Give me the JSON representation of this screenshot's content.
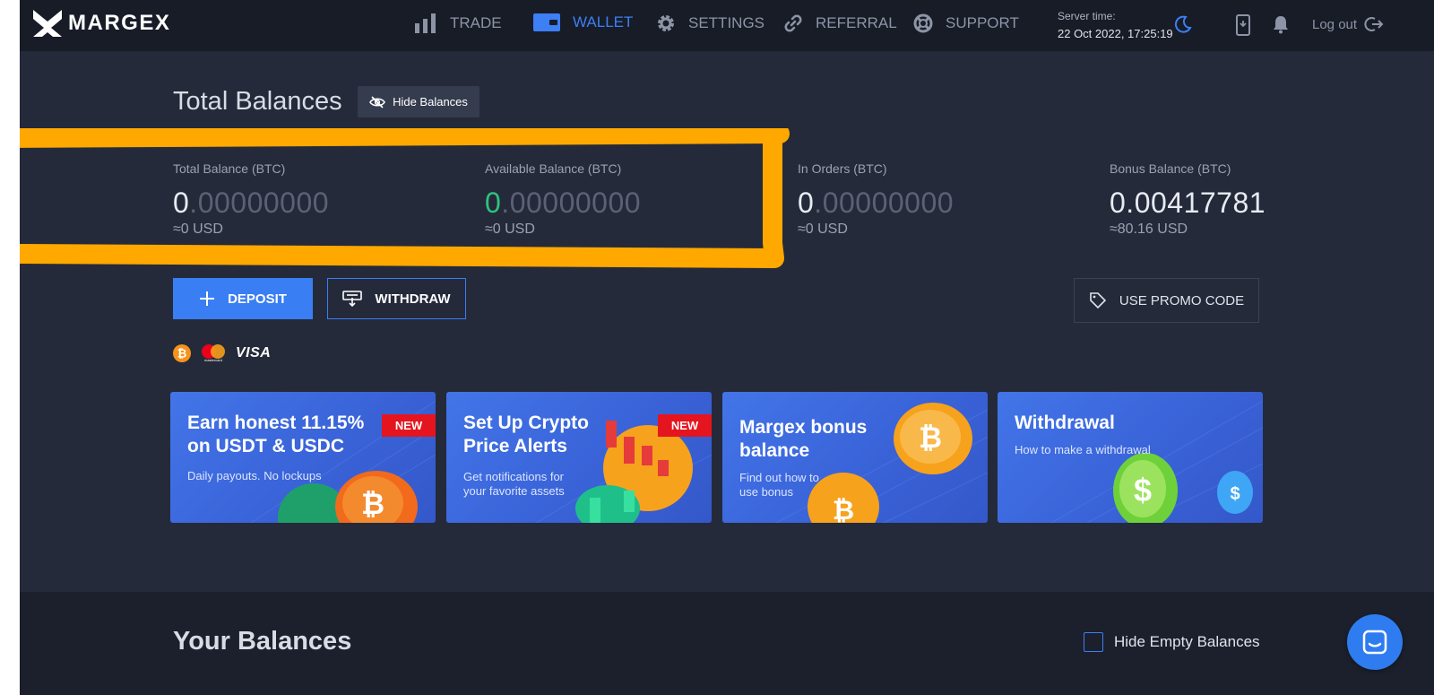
{
  "brand": {
    "name": "MARGEX"
  },
  "nav": [
    {
      "label": "TRADE",
      "icon": "bar-chart-icon"
    },
    {
      "label": "WALLET",
      "icon": "wallet-icon",
      "active": true
    },
    {
      "label": "SETTINGS",
      "icon": "gear-icon"
    },
    {
      "label": "REFERRAL",
      "icon": "link-icon"
    },
    {
      "label": "SUPPORT",
      "icon": "lifebuoy-icon"
    }
  ],
  "server": {
    "label": "Server time:",
    "time": "22 Oct 2022, 17:25:19"
  },
  "header_actions": {
    "logout": "Log out"
  },
  "total": {
    "title": "Total Balances",
    "hide_label": "Hide Balances",
    "items": [
      {
        "label": "Total Balance (BTC)",
        "int": "0",
        "frac": ".00000000",
        "usd": "≈0 USD"
      },
      {
        "label": "Available Balance (BTC)",
        "int": "0",
        "frac": ".00000000",
        "usd": "≈0 USD"
      },
      {
        "label": "In Orders (BTC)",
        "int": "0",
        "frac": ".00000000",
        "usd": "≈0 USD"
      },
      {
        "label": "Bonus Balance (BTC)",
        "int": "0.00417781",
        "frac": "",
        "usd": "≈80.16 USD"
      }
    ]
  },
  "actions": {
    "deposit": "DEPOSIT",
    "withdraw": "WITHDRAW",
    "promo": "USE PROMO CODE"
  },
  "payment": {
    "visa": "VISA",
    "mastercard": "mastercard"
  },
  "banners": [
    {
      "title": "Earn honest 11.15%\non USDT & USDC",
      "subtitle": "Daily payouts. No lockups",
      "badge": "NEW"
    },
    {
      "title": "Set Up Crypto\nPrice Alerts",
      "subtitle": "Get notifications for\nyour favorite assets",
      "badge": "NEW"
    },
    {
      "title": "Margex bonus\nbalance",
      "subtitle": "Find out how to\nuse bonus",
      "badge": ""
    },
    {
      "title": "Withdrawal",
      "subtitle": "How to make a withdrawal",
      "badge": ""
    }
  ],
  "your_balances": {
    "title": "Your Balances",
    "hide_empty": "Hide Empty Balances"
  },
  "colors": {
    "accent": "#3a7ef4",
    "highlight": "#ffa800",
    "green": "#2ec27e",
    "new_badge": "#e5151f"
  }
}
